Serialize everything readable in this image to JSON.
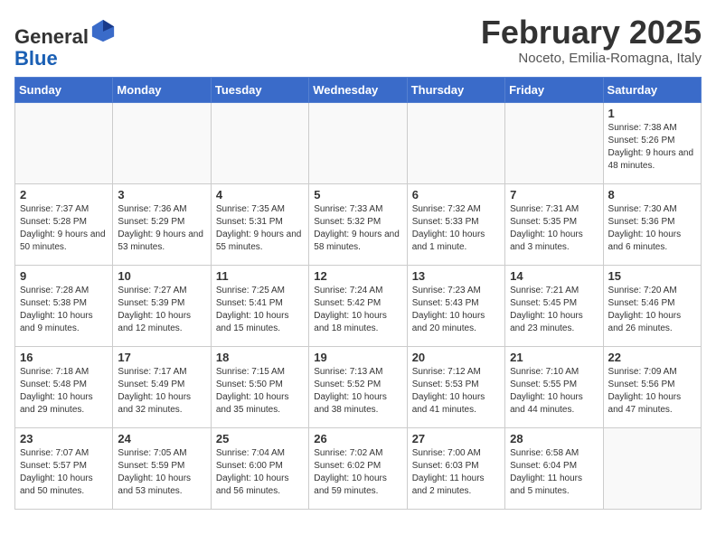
{
  "header": {
    "logo_general": "General",
    "logo_blue": "Blue",
    "month_title": "February 2025",
    "location": "Noceto, Emilia-Romagna, Italy"
  },
  "days_of_week": [
    "Sunday",
    "Monday",
    "Tuesday",
    "Wednesday",
    "Thursday",
    "Friday",
    "Saturday"
  ],
  "weeks": [
    [
      {
        "day": "",
        "info": ""
      },
      {
        "day": "",
        "info": ""
      },
      {
        "day": "",
        "info": ""
      },
      {
        "day": "",
        "info": ""
      },
      {
        "day": "",
        "info": ""
      },
      {
        "day": "",
        "info": ""
      },
      {
        "day": "1",
        "info": "Sunrise: 7:38 AM\nSunset: 5:26 PM\nDaylight: 9 hours and 48 minutes."
      }
    ],
    [
      {
        "day": "2",
        "info": "Sunrise: 7:37 AM\nSunset: 5:28 PM\nDaylight: 9 hours and 50 minutes."
      },
      {
        "day": "3",
        "info": "Sunrise: 7:36 AM\nSunset: 5:29 PM\nDaylight: 9 hours and 53 minutes."
      },
      {
        "day": "4",
        "info": "Sunrise: 7:35 AM\nSunset: 5:31 PM\nDaylight: 9 hours and 55 minutes."
      },
      {
        "day": "5",
        "info": "Sunrise: 7:33 AM\nSunset: 5:32 PM\nDaylight: 9 hours and 58 minutes."
      },
      {
        "day": "6",
        "info": "Sunrise: 7:32 AM\nSunset: 5:33 PM\nDaylight: 10 hours and 1 minute."
      },
      {
        "day": "7",
        "info": "Sunrise: 7:31 AM\nSunset: 5:35 PM\nDaylight: 10 hours and 3 minutes."
      },
      {
        "day": "8",
        "info": "Sunrise: 7:30 AM\nSunset: 5:36 PM\nDaylight: 10 hours and 6 minutes."
      }
    ],
    [
      {
        "day": "9",
        "info": "Sunrise: 7:28 AM\nSunset: 5:38 PM\nDaylight: 10 hours and 9 minutes."
      },
      {
        "day": "10",
        "info": "Sunrise: 7:27 AM\nSunset: 5:39 PM\nDaylight: 10 hours and 12 minutes."
      },
      {
        "day": "11",
        "info": "Sunrise: 7:25 AM\nSunset: 5:41 PM\nDaylight: 10 hours and 15 minutes."
      },
      {
        "day": "12",
        "info": "Sunrise: 7:24 AM\nSunset: 5:42 PM\nDaylight: 10 hours and 18 minutes."
      },
      {
        "day": "13",
        "info": "Sunrise: 7:23 AM\nSunset: 5:43 PM\nDaylight: 10 hours and 20 minutes."
      },
      {
        "day": "14",
        "info": "Sunrise: 7:21 AM\nSunset: 5:45 PM\nDaylight: 10 hours and 23 minutes."
      },
      {
        "day": "15",
        "info": "Sunrise: 7:20 AM\nSunset: 5:46 PM\nDaylight: 10 hours and 26 minutes."
      }
    ],
    [
      {
        "day": "16",
        "info": "Sunrise: 7:18 AM\nSunset: 5:48 PM\nDaylight: 10 hours and 29 minutes."
      },
      {
        "day": "17",
        "info": "Sunrise: 7:17 AM\nSunset: 5:49 PM\nDaylight: 10 hours and 32 minutes."
      },
      {
        "day": "18",
        "info": "Sunrise: 7:15 AM\nSunset: 5:50 PM\nDaylight: 10 hours and 35 minutes."
      },
      {
        "day": "19",
        "info": "Sunrise: 7:13 AM\nSunset: 5:52 PM\nDaylight: 10 hours and 38 minutes."
      },
      {
        "day": "20",
        "info": "Sunrise: 7:12 AM\nSunset: 5:53 PM\nDaylight: 10 hours and 41 minutes."
      },
      {
        "day": "21",
        "info": "Sunrise: 7:10 AM\nSunset: 5:55 PM\nDaylight: 10 hours and 44 minutes."
      },
      {
        "day": "22",
        "info": "Sunrise: 7:09 AM\nSunset: 5:56 PM\nDaylight: 10 hours and 47 minutes."
      }
    ],
    [
      {
        "day": "23",
        "info": "Sunrise: 7:07 AM\nSunset: 5:57 PM\nDaylight: 10 hours and 50 minutes."
      },
      {
        "day": "24",
        "info": "Sunrise: 7:05 AM\nSunset: 5:59 PM\nDaylight: 10 hours and 53 minutes."
      },
      {
        "day": "25",
        "info": "Sunrise: 7:04 AM\nSunset: 6:00 PM\nDaylight: 10 hours and 56 minutes."
      },
      {
        "day": "26",
        "info": "Sunrise: 7:02 AM\nSunset: 6:02 PM\nDaylight: 10 hours and 59 minutes."
      },
      {
        "day": "27",
        "info": "Sunrise: 7:00 AM\nSunset: 6:03 PM\nDaylight: 11 hours and 2 minutes."
      },
      {
        "day": "28",
        "info": "Sunrise: 6:58 AM\nSunset: 6:04 PM\nDaylight: 11 hours and 5 minutes."
      },
      {
        "day": "",
        "info": ""
      }
    ]
  ]
}
